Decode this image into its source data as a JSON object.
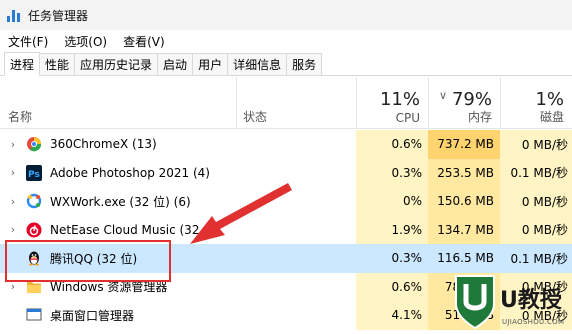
{
  "window": {
    "title": "任务管理器"
  },
  "menu": [
    "文件(F)",
    "选项(O)",
    "查看(V)"
  ],
  "tabs": [
    "进程",
    "性能",
    "应用历史记录",
    "启动",
    "用户",
    "详细信息",
    "服务"
  ],
  "header": {
    "name_label": "名称",
    "status_label": "状态",
    "cpu": {
      "percent": "11%",
      "label": "CPU"
    },
    "memory": {
      "percent": "79%",
      "label": "内存"
    },
    "disk": {
      "percent": "1%",
      "label": "磁盘"
    }
  },
  "processes": [
    {
      "name": "360ChromeX (13)",
      "cpu": "0.6%",
      "memory": "737.2 MB",
      "disk": "0 MB/秒",
      "icon": "chrome-360-icon"
    },
    {
      "name": "Adobe Photoshop 2021 (4)",
      "cpu": "0.3%",
      "memory": "253.5 MB",
      "disk": "0.1 MB/秒",
      "icon": "photoshop-icon"
    },
    {
      "name": "WXWork.exe (32 位) (6)",
      "cpu": "0%",
      "memory": "150.6 MB",
      "disk": "0 MB/秒",
      "icon": "wxwork-icon"
    },
    {
      "name": "NetEase Cloud Music (32",
      "cpu": "1.9%",
      "memory": "134.7 MB",
      "disk": "0 MB/秒",
      "icon": "netease-music-icon"
    },
    {
      "name": "腾讯QQ (32 位)",
      "cpu": "0.3%",
      "memory": "116.5 MB",
      "disk": "0.1 MB/秒",
      "icon": "qq-penguin-icon",
      "selected": true
    },
    {
      "name": "Windows 资源管理器",
      "cpu": "0.6%",
      "memory": "78.2 MB",
      "disk": "0 MB/秒",
      "icon": "folder-icon"
    },
    {
      "name": "桌面窗口管理器",
      "cpu": "4.1%",
      "memory": "51.6 MB",
      "disk": "0 MB/秒",
      "icon": "desktop-window-icon"
    }
  ],
  "watermark": {
    "brand": "U教授",
    "url": "UJIAOSHOU.COM"
  },
  "colors": {
    "annotation_red": "#e03030",
    "selected_row": "#cce8ff",
    "heat_light": "#fff4c4",
    "heat_mid": "#ffe9a0"
  }
}
